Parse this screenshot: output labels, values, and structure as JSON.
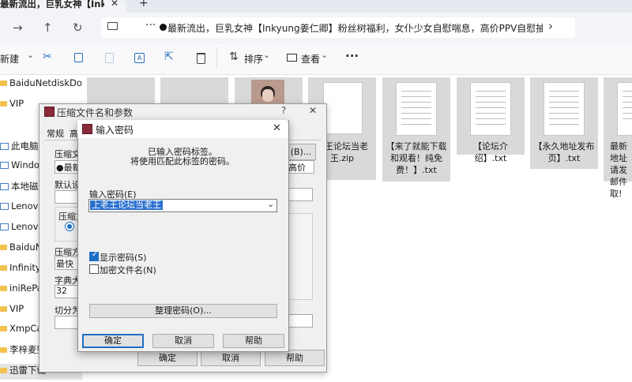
{
  "browser": {
    "tab_title": "最新流出，巨乳女神【Inkyu",
    "tab_close_icon": "✕",
    "new_tab_icon": "+",
    "breadcrumb": "最新流出，巨乳女神【Inkyung姜仁卿】粉丝树福利，女仆少女自慰喘息，高价PPV自慰抽搐",
    "more_label": "···"
  },
  "commands": {
    "new_label": "新建",
    "sort_label": "排序",
    "view_label": "查看",
    "more_label": "···"
  },
  "sidebar": {
    "items": [
      {
        "label": "BaiduNetdiskDo"
      },
      {
        "label": "VIP"
      },
      {
        "label": "此电脑"
      },
      {
        "label": "Window"
      },
      {
        "label": "本地磁盘"
      },
      {
        "label": "Lenovo ("
      },
      {
        "label": "Lenovo (E"
      },
      {
        "label": "BaiduNe"
      },
      {
        "label": "InfinityN"
      },
      {
        "label": "iniRePat"
      },
      {
        "label": "VIP"
      },
      {
        "label": "XmpCac"
      },
      {
        "label": "李梓麦整"
      },
      {
        "label": "迅雷下载"
      }
    ]
  },
  "files": [
    {
      "name": "老王论坛当老王.zip"
    },
    {
      "name": "【来了就能下载和观看！纯免费！】.txt"
    },
    {
      "name": "【论坛介绍】.txt"
    },
    {
      "name": "【永久地址发布页】.txt"
    },
    {
      "name": "最新地址请发邮件取!"
    }
  ],
  "archive_dialog": {
    "title": "压缩文件名和参数",
    "help_icon": "?",
    "close_icon": "✕",
    "tab_general": "常规",
    "tab_second": "高",
    "archive_name_label": "压缩文件",
    "archive_name_value": "●最新",
    "browse_label": "(B)...",
    "profile_label": "默认设置",
    "format_label": "压缩文",
    "method_label": "压缩方",
    "method_value": "最快",
    "dict_label": "字典大小",
    "dict_value": "32",
    "split_label": "切分为分",
    "update_mode_value": "高价",
    "ok_label": "确定",
    "cancel_label": "取消",
    "help_label": "帮助"
  },
  "password_dialog": {
    "title": "输入密码",
    "close_icon": "✕",
    "info_line1": "已输入密码标签。",
    "info_line2": "将使用匹配此标签的密码。",
    "password_label": "输入密码(E)",
    "password_value": "上老王论坛当老王",
    "show_password_label": "显示密码(S)",
    "show_password_checked": true,
    "encrypt_names_label": "加密文件名(N)",
    "encrypt_names_checked": false,
    "organize_label": "整理密码(O)...",
    "ok_label": "确定",
    "cancel_label": "取消",
    "help_label": "帮助"
  }
}
